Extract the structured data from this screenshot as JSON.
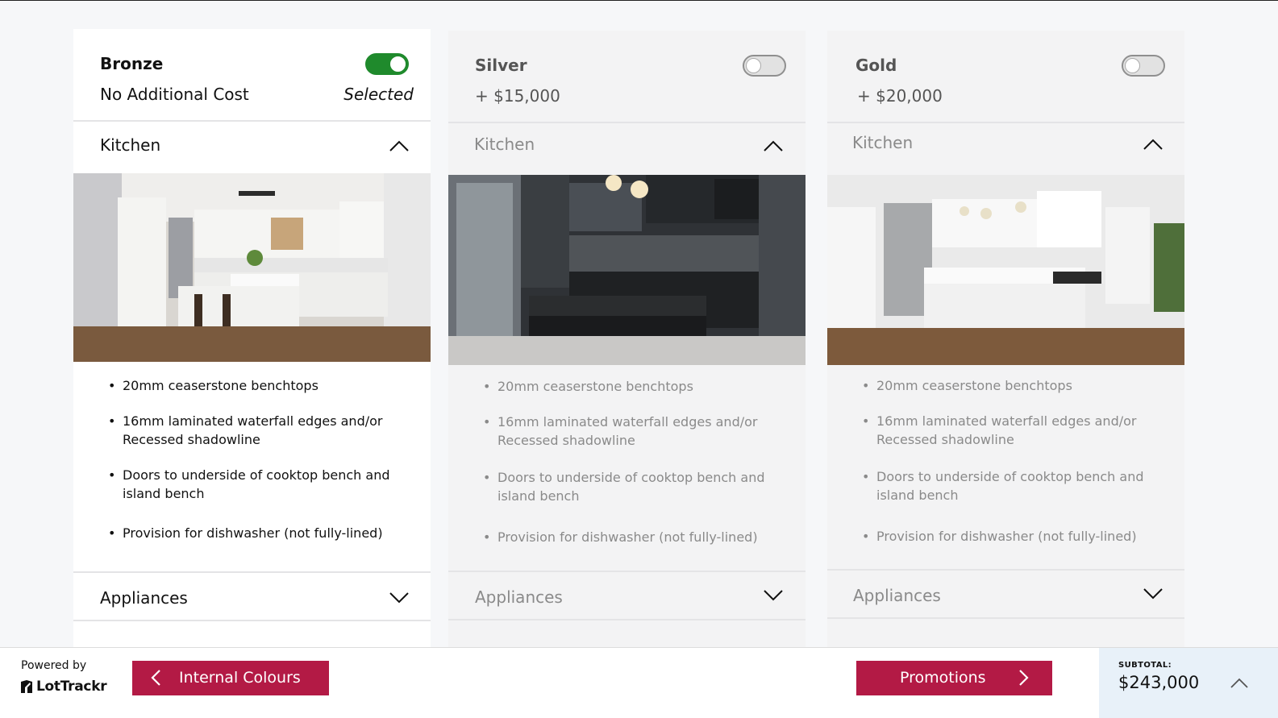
{
  "tiers": [
    {
      "name": "Bronze",
      "price": "No Additional Cost",
      "status": "Selected",
      "enabled": true,
      "section_title": "Kitchen",
      "photo": "white-kitchen-photo",
      "features": [
        "20mm ceaserstone benchtops",
        "16mm laminated waterfall edges and/or Recessed shadowline",
        "Doors to underside of cooktop bench and island bench",
        "Provision for dishwasher (not fully-lined)"
      ],
      "next_section_title": "Appliances"
    },
    {
      "name": "Silver",
      "price": "+ $15,000",
      "status": "",
      "enabled": false,
      "section_title": "Kitchen",
      "photo": "dark-kitchen-photo",
      "features": [
        "20mm ceaserstone benchtops",
        "16mm laminated waterfall edges and/or Recessed shadowline",
        "Doors to underside of cooktop bench and island bench",
        "Provision for dishwasher (not fully-lined)"
      ],
      "next_section_title": "Appliances"
    },
    {
      "name": "Gold",
      "price": "+ $20,000",
      "status": "",
      "enabled": false,
      "section_title": "Kitchen",
      "photo": "bright-kitchen-photo",
      "features": [
        "20mm ceaserstone benchtops",
        "16mm laminated waterfall edges and/or Recessed shadowline",
        "Doors to underside of cooktop bench and island bench",
        "Provision for dishwasher (not fully-lined)"
      ],
      "next_section_title": "Appliances"
    }
  ],
  "footer": {
    "powered_by": "Powered by",
    "brand": "LotTrackr",
    "prev_label": "Internal Colours",
    "next_label": "Promotions",
    "subtotal_label": "SUBTOTAL:",
    "subtotal_value": "$243,000"
  },
  "colors": {
    "accent": "#b31a45",
    "toggle_on": "#1f8a2c",
    "subtotal_bg": "#e8f1f9"
  }
}
